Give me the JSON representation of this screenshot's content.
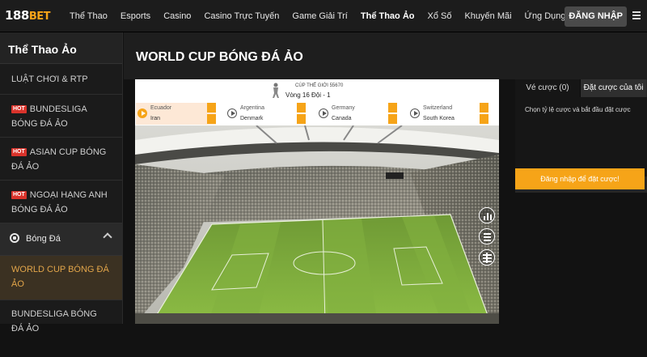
{
  "header": {
    "logo_main": "188",
    "logo_accent": "BET",
    "nav": [
      "Thể Thao",
      "Esports",
      "Casino",
      "Casino Trực Tuyến",
      "Game Giải Trí",
      "Thể Thao Ảo",
      "Xổ Số",
      "Khuyến Mãi",
      "Ứng Dụng"
    ],
    "active_nav": "Thể Thao Ảo",
    "login_label": "ĐĂNG NHẬP"
  },
  "sidebar": {
    "title": "Thể Thao Ảo",
    "rules": "LUẬT CHƠI & RTP",
    "hot_badge": "HOT",
    "bundesliga_hot": "BUNDESLIGA BÓNG ĐÁ ẢO",
    "asian_cup_hot": "ASIAN CUP BÓNG ĐÁ ẢO",
    "premier_hot": "NGOẠI HẠNG ANH BÓNG ĐÁ ẢO",
    "soccer": "Bóng Đá",
    "world_cup": "WORLD CUP BÓNG ĐÁ ẢO",
    "bundesliga": "BUNDESLIGA BÓNG ĐÁ ẢO"
  },
  "main": {
    "title": "WORLD CUP BÓNG ĐÁ ẢO",
    "cup_line1": "CÚP THẾ GIỚI 55670",
    "cup_line2": "Vòng 16 Đội - 1",
    "matches": [
      {
        "home": "Ecuador",
        "away": "Iran"
      },
      {
        "home": "Argentina",
        "away": "Denmark"
      },
      {
        "home": "Germany",
        "away": "Canada"
      },
      {
        "home": "Switzerland",
        "away": "South Korea"
      }
    ]
  },
  "betslip": {
    "tab_ticket": "Vé cược (0)",
    "tab_mybets": "Đặt cược của tôi",
    "hint": "Chọn tỷ lệ cược và bắt đầu đặt cược",
    "login_prompt": "Đăng nhập để đặt cược!"
  },
  "colors": {
    "accent": "#f6a418",
    "hot": "#d9332b",
    "active_bg": "#3b3122"
  }
}
